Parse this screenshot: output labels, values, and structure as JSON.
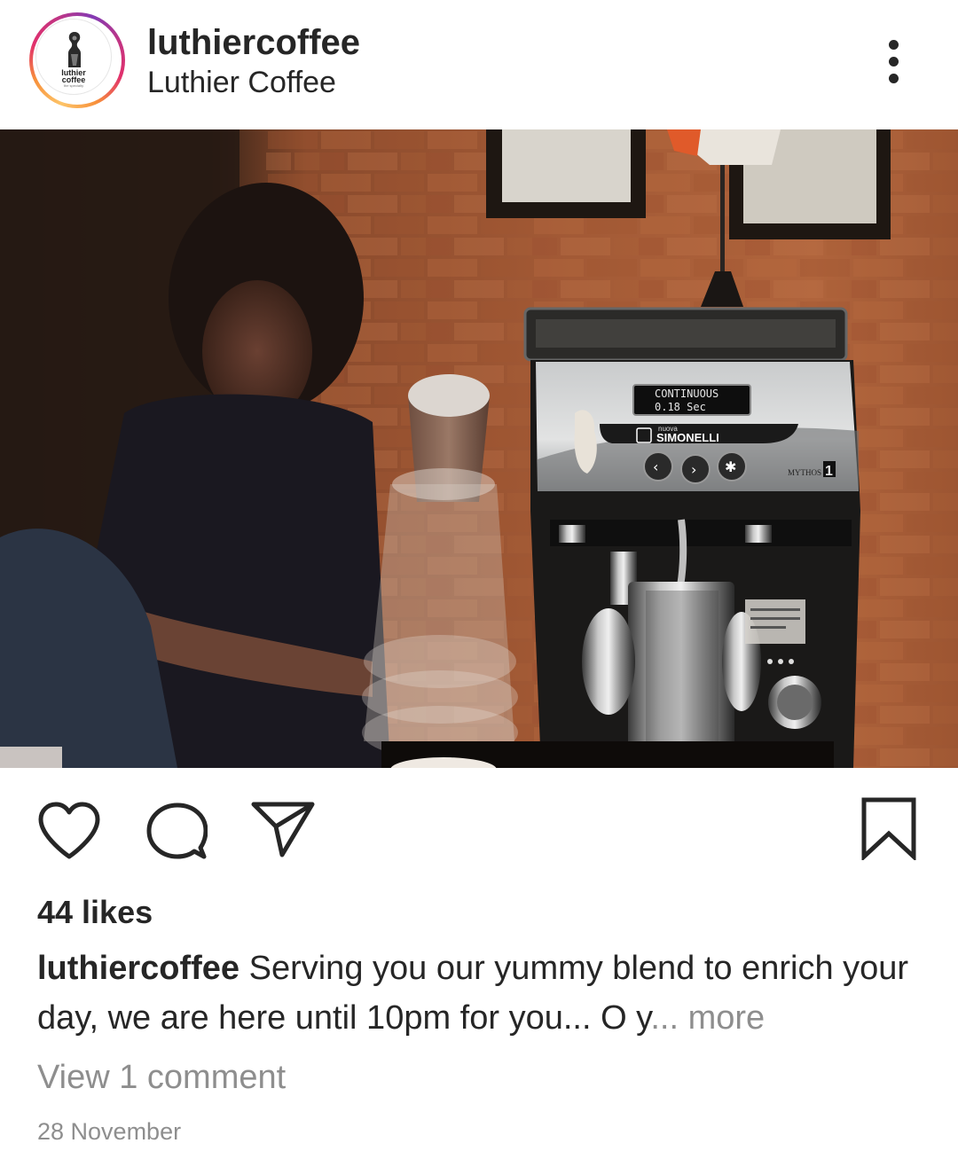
{
  "post": {
    "username": "luthiercoffee",
    "display_name": "Luthier Coffee",
    "avatar_logo": {
      "line1": "luthier",
      "line2": "coffee",
      "line3": "the specialty"
    },
    "more_icon": "three-dots-vertical-icon",
    "photo": {
      "grinder_display_line1": "CONTINUOUS",
      "grinder_display_line2": "0.18   Sec",
      "grinder_brand_small": "nuova",
      "grinder_brand": "SIMONELLI",
      "grinder_model": "MYTHOS"
    },
    "actions": {
      "like_icon": "heart-outline-icon",
      "comment_icon": "speech-bubble-icon",
      "share_icon": "paper-plane-icon",
      "save_icon": "bookmark-outline-icon"
    },
    "likes_text": "44 likes",
    "caption": {
      "user": "luthiercoffee",
      "text": " Serving you our yummy blend to enrich your day, we are here until 10pm for you... O y",
      "more": "... more"
    },
    "view_comments": "View 1 comment",
    "timestamp": "28 November"
  },
  "colors": {
    "text": "#262626",
    "secondary_text": "#8e8e8e",
    "story_ring_start": "#fdc468",
    "story_ring_end": "#c13584"
  }
}
